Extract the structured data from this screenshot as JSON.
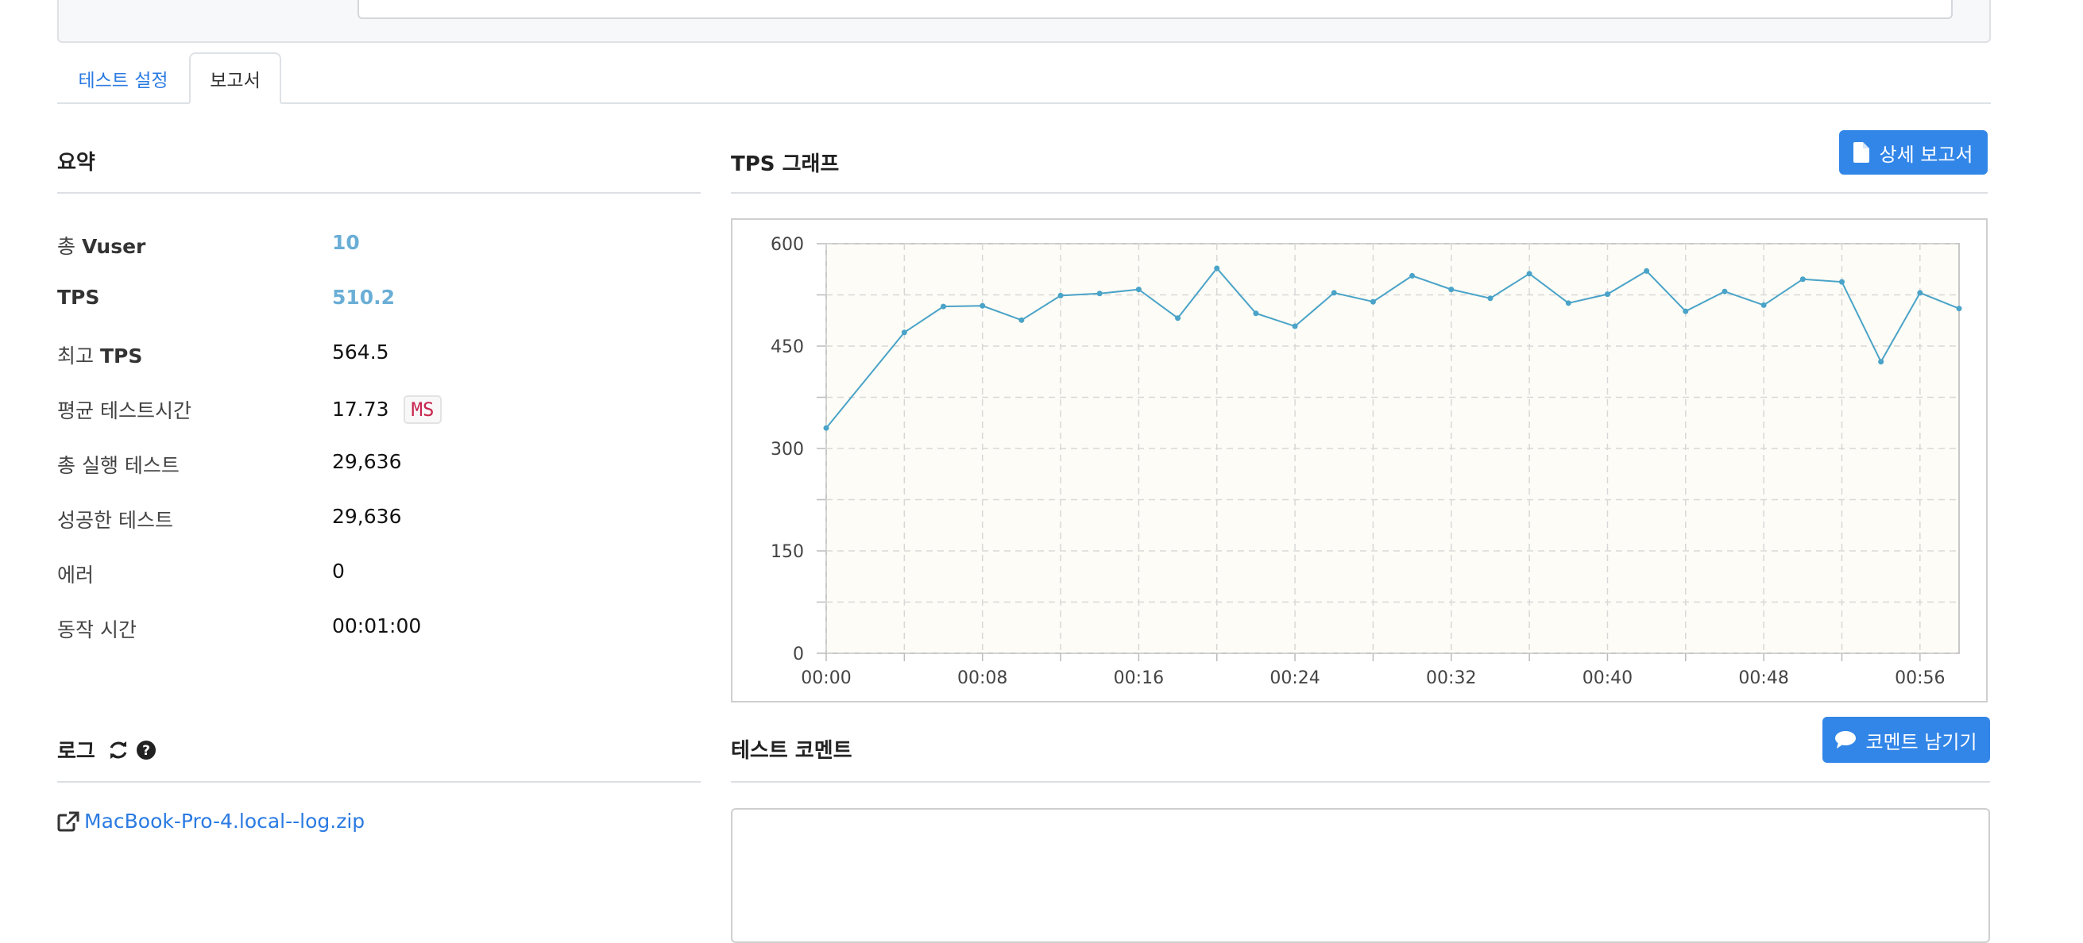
{
  "tabs": {
    "settings": "테스트 설정",
    "report": "보고서"
  },
  "summary": {
    "title": "요약",
    "rows": [
      {
        "label_pre": "총 ",
        "label_bold": "Vuser",
        "value": "10"
      },
      {
        "label_pre": "",
        "label_bold": "TPS",
        "value": "510.2"
      },
      {
        "label_pre": "최고 ",
        "label_bold": "TPS",
        "value": "564.5"
      },
      {
        "label_pre": "평균 테스트시간",
        "label_bold": "",
        "value": "17.73",
        "unit": "MS"
      },
      {
        "label_pre": "총 실행 테스트",
        "label_bold": "",
        "value": "29,636"
      },
      {
        "label_pre": "성공한 테스트",
        "label_bold": "",
        "value": "29,636"
      },
      {
        "label_pre": "에러",
        "label_bold": "",
        "value": "0"
      },
      {
        "label_pre": "동작 시간",
        "label_bold": "",
        "value": "00:01:00"
      }
    ]
  },
  "tps": {
    "title": "TPS 그래프",
    "detail_button": "상세 보고서"
  },
  "log": {
    "title": "로그",
    "file": "MacBook-Pro-4.local--log.zip"
  },
  "comment": {
    "title": "테스트 코멘트",
    "button": "코멘트 남기기"
  },
  "colors": {
    "accent": "#3286e8",
    "line": "#4aa3c8",
    "highlight": "#6aaed6",
    "badge_text": "#c7254e"
  },
  "icons": {
    "refresh": "refresh-icon",
    "help": "question-circle-icon",
    "external": "external-link-icon",
    "file": "file-icon",
    "comment": "comment-icon"
  },
  "chart_data": {
    "type": "line",
    "xlabel": "",
    "ylabel": "",
    "x_unit": "mm:ss",
    "xlim": [
      0,
      58
    ],
    "ylim": [
      0,
      600
    ],
    "yticks": [
      0,
      150,
      300,
      450,
      600
    ],
    "xticks": [
      "00:00",
      "00:08",
      "00:16",
      "00:24",
      "00:32",
      "00:40",
      "00:48",
      "00:56"
    ],
    "xtick_seconds": [
      0,
      8,
      16,
      24,
      32,
      40,
      48,
      56
    ],
    "grid": true,
    "series": [
      {
        "x": [
          0,
          4,
          6,
          8,
          10,
          12,
          14,
          16,
          18,
          20,
          22,
          24,
          26,
          28,
          30,
          32,
          34,
          36,
          38,
          40,
          42,
          44,
          46,
          48,
          50,
          52,
          54,
          56,
          58
        ],
        "values": [
          330,
          470,
          508,
          509,
          488,
          524,
          527,
          533,
          491,
          564,
          498,
          479,
          528,
          515,
          553,
          533,
          520,
          556,
          513,
          526,
          560,
          501,
          530,
          510,
          548,
          544,
          427,
          528,
          505
        ]
      }
    ]
  }
}
